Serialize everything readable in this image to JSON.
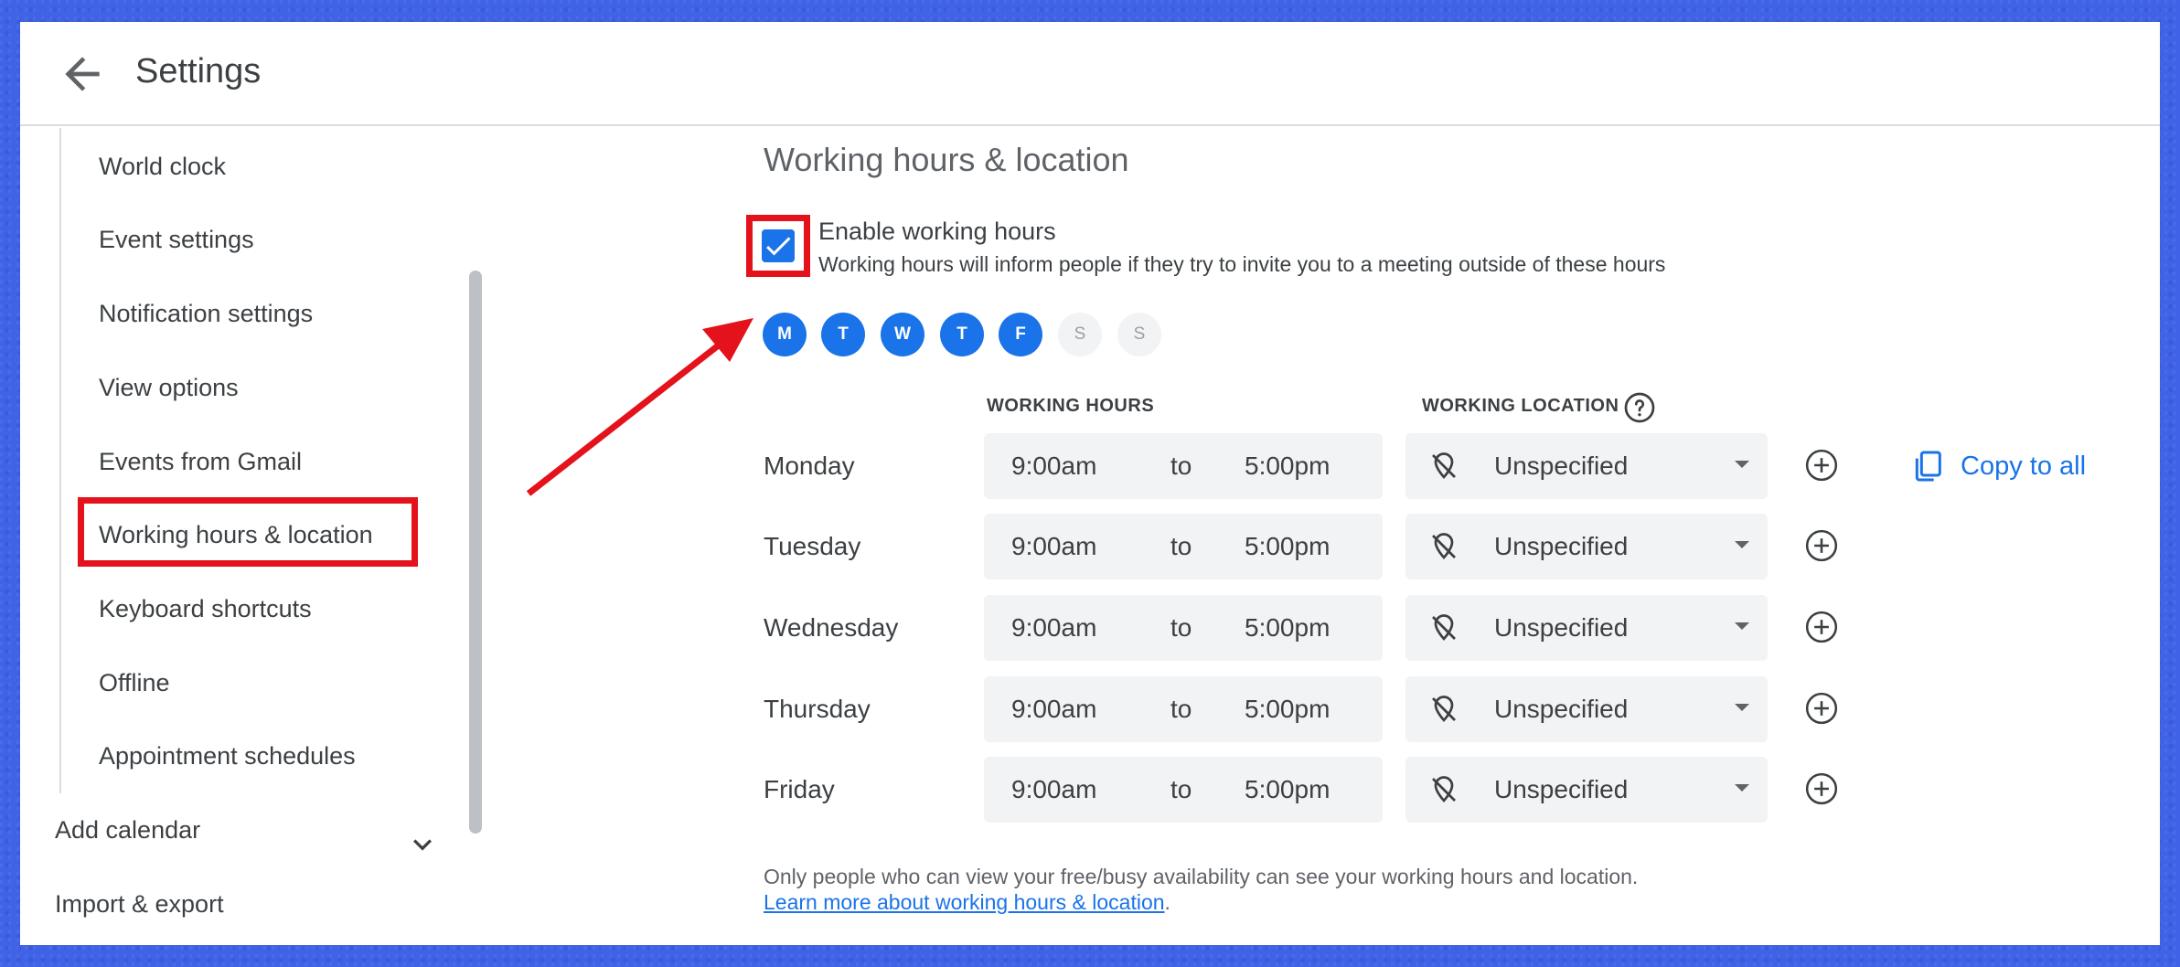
{
  "header": {
    "title": "Settings"
  },
  "sidebar": {
    "items": [
      "World clock",
      "Event settings",
      "Notification settings",
      "View options",
      "Events from Gmail",
      "Working hours & location",
      "Keyboard shortcuts",
      "Offline",
      "Appointment schedules"
    ],
    "add_calendar": "Add calendar",
    "import_export": "Import & export"
  },
  "main": {
    "section_title": "Working hours & location",
    "enable_label": "Enable working hours",
    "enable_checked": true,
    "enable_desc": "Working hours will inform people if they try to invite you to a meeting outside of these hours",
    "days": [
      {
        "letter": "M",
        "on": true
      },
      {
        "letter": "T",
        "on": true
      },
      {
        "letter": "W",
        "on": true
      },
      {
        "letter": "T",
        "on": true
      },
      {
        "letter": "F",
        "on": true
      },
      {
        "letter": "S",
        "on": false
      },
      {
        "letter": "S",
        "on": false
      }
    ],
    "col_working_hours": "WORKING HOURS",
    "col_working_location": "WORKING LOCATION",
    "rows": [
      {
        "day": "Monday",
        "start": "9:00am",
        "to": "to",
        "end": "5:00pm",
        "location": "Unspecified"
      },
      {
        "day": "Tuesday",
        "start": "9:00am",
        "to": "to",
        "end": "5:00pm",
        "location": "Unspecified"
      },
      {
        "day": "Wednesday",
        "start": "9:00am",
        "to": "to",
        "end": "5:00pm",
        "location": "Unspecified"
      },
      {
        "day": "Thursday",
        "start": "9:00am",
        "to": "to",
        "end": "5:00pm",
        "location": "Unspecified"
      },
      {
        "day": "Friday",
        "start": "9:00am",
        "to": "to",
        "end": "5:00pm",
        "location": "Unspecified"
      }
    ],
    "copy_to_all": "Copy to all",
    "footer_note": "Only people who can view your free/busy availability can see your working hours and location.",
    "footer_link": "Learn more about working hours & location",
    "footer_period": "."
  },
  "colors": {
    "accent": "#1a73e8",
    "annotation": "#e3121b",
    "background": "#3f62e6"
  },
  "icons": {
    "back": "arrow-left-icon",
    "checkbox": "checkmark-icon",
    "help": "help-circle-icon",
    "location_off": "location-off-icon",
    "add": "add-circle-icon",
    "copy": "copy-icon",
    "chevron": "chevron-down-icon"
  }
}
